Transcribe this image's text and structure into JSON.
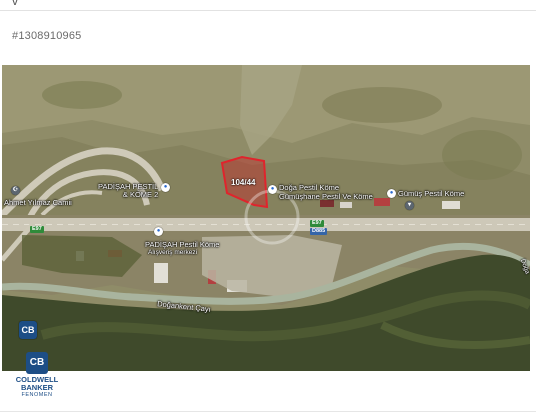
{
  "page": {
    "top_fragment": "v",
    "listing_id": "#1308910965"
  },
  "map": {
    "parcel_label": "104/44",
    "road_badges": [
      "E97",
      "E97",
      "D885"
    ],
    "places": [
      {
        "name": "Ahmet Yılmaz Camii",
        "icon": "mosque-icon"
      },
      {
        "name": "PADİŞAH PESTİL\n& KÖME 2",
        "icon": "shop-icon"
      },
      {
        "name": "Doğa Pestil Köme",
        "icon": "shop-icon"
      },
      {
        "name": "Gümüşhane Pestil Ve Köme",
        "icon": "shop-icon"
      },
      {
        "name": "Gümüş Pestil Köme",
        "icon": "shop-icon"
      },
      {
        "name": "PADİŞAH Pestil Köme",
        "icon": "shop-icon"
      },
      {
        "name": "Alışveriş merkezi",
        "icon": "mall-icon"
      },
      {
        "name": "Doğankent Çayı",
        "icon": "river"
      },
      {
        "name": "Doğa",
        "icon": "label"
      }
    ],
    "colors": {
      "parcel_outline": "#e0242c",
      "parcel_fill": "#c42a2a",
      "road": "#c8c4b6",
      "river": "#a8b6a0",
      "forest": "#3f4a2a"
    }
  },
  "brand": {
    "mark": "CB",
    "name_line1": "COLDWELL",
    "name_line2": "BANKER",
    "tagline": "FENOMEN"
  }
}
